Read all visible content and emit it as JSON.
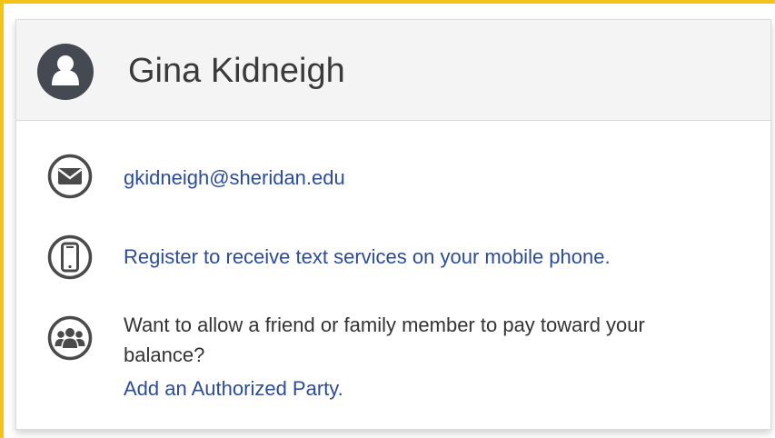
{
  "profile": {
    "name": "Gina Kidneigh"
  },
  "contact": {
    "email": "gkidneigh@sheridan.edu",
    "mobile_link": "Register to receive text services on your mobile phone.",
    "authorized_text_line1": "Want to allow a friend or family member to pay toward your",
    "authorized_text_line2": "balance?",
    "authorized_link": "Add an Authorized Party."
  },
  "colors": {
    "frame_border": "#f5c21a",
    "header_bg": "#f4f4f4",
    "link": "#2c4c97",
    "icon": "#4a4a4a"
  },
  "icons": {
    "avatar": "user-avatar-icon",
    "email": "envelope-icon",
    "mobile": "mobile-phone-icon",
    "group": "group-icon"
  }
}
